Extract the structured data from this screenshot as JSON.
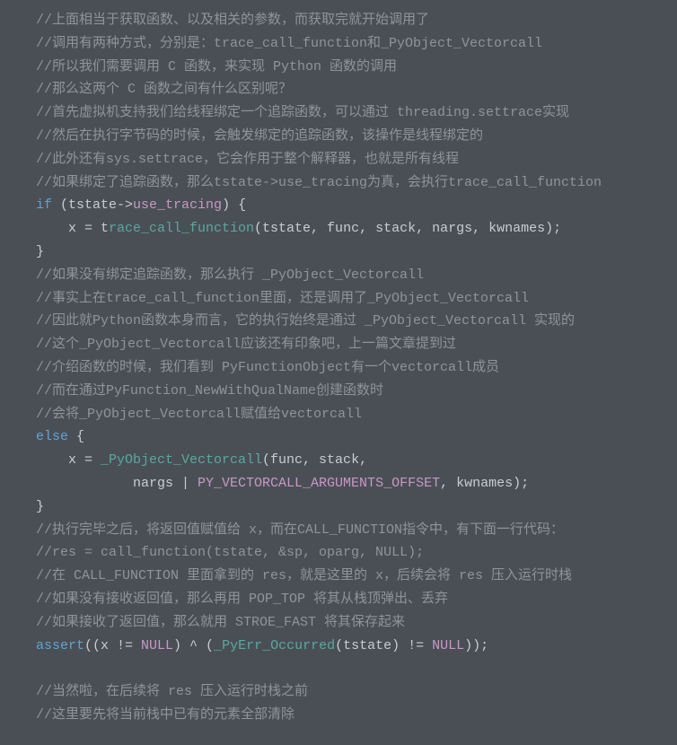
{
  "code": {
    "c01": "//上面相当于获取函数、以及相关的参数，而获取完就开始调用了",
    "c02": "//调用有两种方式，分别是：trace_call_function和_PyObject_Vectorcall",
    "c03": "//所以我们需要调用 C 函数，来实现 Python 函数的调用",
    "c04": "//那么这两个 C 函数之间有什么区别呢？",
    "c05": "//首先虚拟机支持我们给线程绑定一个追踪函数，可以通过 threading.settrace实现",
    "c06": "//然后在执行字节码的时候，会触发绑定的追踪函数，该操作是线程绑定的",
    "c07": "//此外还有sys.settrace，它会作用于整个解释器，也就是所有线程",
    "c08": "//如果绑定了追踪函数，那么tstate->use_tracing为真，会执行trace_call_function",
    "kw_if": "if",
    "if_open": " (tstate",
    "arrow1": "->",
    "mem_use": "use_tracing",
    "if_close": ") {",
    "l_assign1a": "    x = t",
    "fn_trace": "race_call_function",
    "l_assign1b": "(tstate, func, stack, nargs, kwnames);",
    "brace1": "}",
    "c09": "//如果没有绑定追踪函数，那么执行 _PyObject_Vectorcall",
    "c10": "//事实上在trace_call_function里面，还是调用了_PyObject_Vectorcall",
    "c11": "//因此就Python函数本身而言，它的执行始终是通过 _PyObject_Vectorcall 实现的",
    "c12": "//这个_PyObject_Vectorcall应该还有印象吧，上一篇文章提到过",
    "c13": "//介绍函数的时候，我们看到 PyFunctionObject有一个vectorcall成员",
    "c14": "//而在通过PyFunction_NewWithQualName创建函数时",
    "c15": "//会将_PyObject_Vectorcall赋值给vectorcall",
    "kw_else": "else",
    "else_open": " {",
    "l_assign2a": "    x = ",
    "fn_vec": "_PyObject_Vectorcall",
    "l_assign2b": "(func, stack,",
    "l_assign3a": "            nargs | ",
    "const_off": "PY_VECTORCALL_ARGUMENTS_OFFSET",
    "l_assign3b": ", kwnames);",
    "brace2": "}",
    "c16": "//执行完毕之后，将返回值赋值给 x，而在CALL_FUNCTION指令中，有下面一行代码：",
    "c17": "//res = call_function(tstate, &sp, oparg, NULL);",
    "c18": "//在 CALL_FUNCTION 里面拿到的 res，就是这里的 x，后续会将 res 压入运行时栈",
    "c19": "//如果没有接收返回值，那么再用 POP_TOP 将其从栈顶弹出、丢弃",
    "c20": "//如果接收了返回值，那么就用 STROE_FAST 将其保存起来",
    "kw_assert": "assert",
    "assert_a": "((x != ",
    "null1": "NULL",
    "assert_b": ") ^ (",
    "fn_err": "_PyErr_Occurred",
    "assert_c": "(tstate) != ",
    "null2": "NULL",
    "assert_d": "));",
    "blank": "",
    "c21": "//当然啦，在后续将 res 压入运行时栈之前",
    "c22": "//这里要先将当前栈中已有的元素全部清除"
  }
}
